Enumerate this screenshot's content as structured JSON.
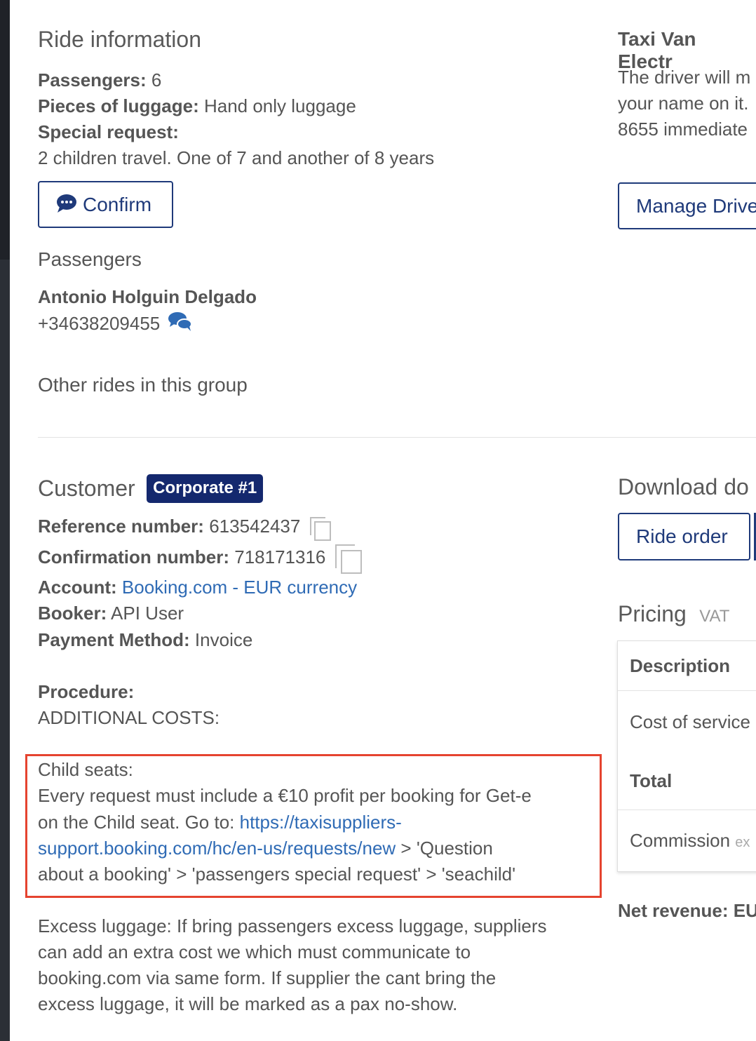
{
  "ride_info": {
    "title": "Ride information",
    "passengers_label": "Passengers:",
    "passengers_value": "6",
    "luggage_label": "Pieces of luggage:",
    "luggage_value": "Hand only luggage",
    "special_request_label": "Special request:",
    "special_request_value": "2 children travel. One of 7 and another of 8 years",
    "confirm_button": "Confirm"
  },
  "passengers_section": {
    "title": "Passengers",
    "name": "Antonio Holguin Delgado",
    "phone": "+34638209455"
  },
  "other_rides": {
    "title": "Other rides in this group"
  },
  "customer": {
    "title": "Customer",
    "badge": "Corporate #1",
    "reference_label": "Reference number:",
    "reference_value": "613542437",
    "confirmation_label": "Confirmation number:",
    "confirmation_value": "718171316",
    "account_label": "Account:",
    "account_value": "Booking.com - EUR currency",
    "booker_label": "Booker:",
    "booker_value": "API User",
    "payment_label": "Payment Method:",
    "payment_value": "Invoice",
    "procedure_label": "Procedure:",
    "procedure_line": "ADDITIONAL COSTS:",
    "child_seats_title": "Child seats:",
    "child_seats_line1": "Every request must include a €10 profit per booking for Get-e",
    "child_seats_line2_prefix": "on the Child seat. Go to: ",
    "child_seats_link_part1": "https://taxisuppliers-",
    "child_seats_link_part2": "support.booking.com/hc/en-us/requests/new",
    "child_seats_line3_suffix": " > 'Question",
    "child_seats_line4": "about a booking' > 'passengers special request' > 'seachild'",
    "excess_line1": "Excess luggage: If bring passengers excess luggage, suppliers",
    "excess_line2": "can add an extra cost we which must communicate to",
    "excess_line3": "booking.com via same form. If supplier the cant bring the",
    "excess_line4": "excess luggage, it will be marked as a pax no-show."
  },
  "right_panel": {
    "vehicle_title": "Taxi Van Electr",
    "driver_line1": "The driver will m",
    "driver_line2": "your name on it.",
    "driver_line3": "8655 immediate",
    "manage_driver_button": "Manage Drive",
    "download_title": "Download do",
    "ride_order_button": "Ride order",
    "pricing_title": "Pricing",
    "pricing_vat": "VAT",
    "table_header": "Description",
    "row_cost": "Cost of service",
    "row_total": "Total",
    "row_commission": "Commission",
    "row_commission_suffix": "ex",
    "net_revenue": "Net revenue: EU"
  },
  "colors": {
    "link": "#2f6bb5",
    "button_border": "#1f3a7a",
    "badge_bg": "#14286e",
    "highlight_border": "#e5432f"
  },
  "icons": {
    "confirm": "chat-bubble-icon",
    "phone": "comments-icon",
    "copy": "copy-icon"
  }
}
